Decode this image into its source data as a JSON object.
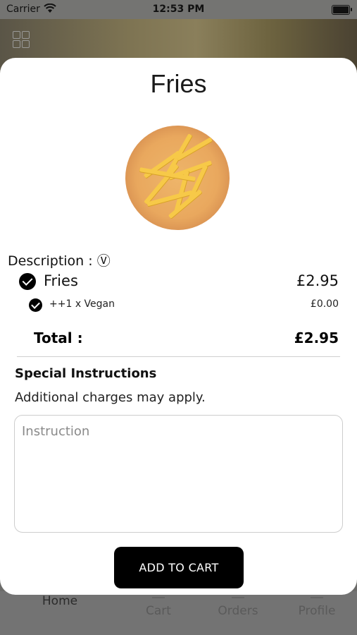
{
  "status_bar": {
    "carrier": "Carrier",
    "time": "12:53 PM"
  },
  "tab_bar": {
    "home": "Home",
    "cart": "Cart",
    "orders": "Orders",
    "profile": "Profile"
  },
  "modal": {
    "title": "Fries",
    "description_label": "Description : Ⓥ",
    "item": {
      "name": "Fries",
      "price": "£2.95"
    },
    "option": {
      "name": "++1 x Vegan",
      "price": "£0.00"
    },
    "total": {
      "label": "Total :",
      "value": "£2.95"
    },
    "special_instructions": {
      "title": "Special Instructions",
      "note": "Additional charges may apply.",
      "placeholder": "Instruction",
      "value": ""
    },
    "add_to_cart_label": "ADD TO CART"
  }
}
